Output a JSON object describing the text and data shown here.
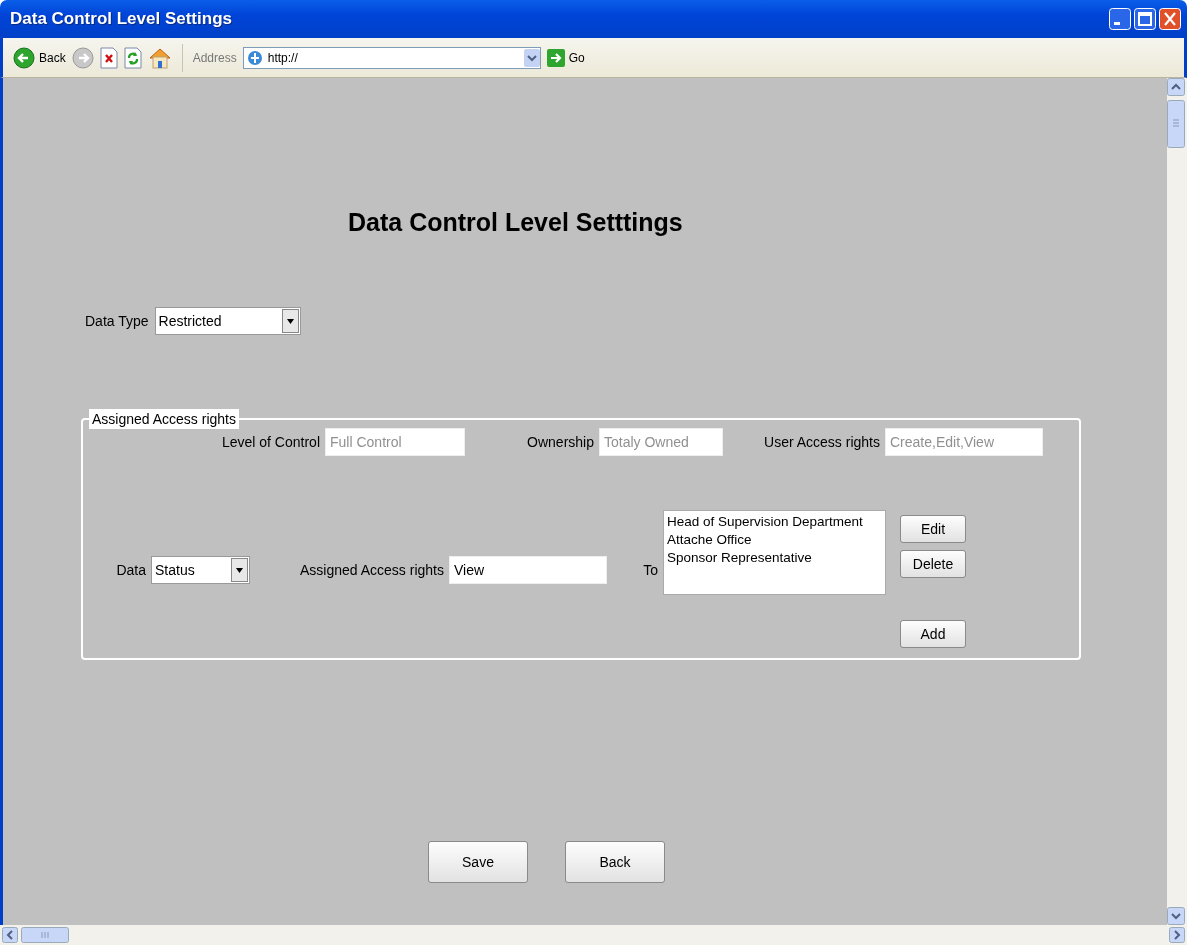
{
  "window": {
    "title": "Data Control Level Settings"
  },
  "toolbar": {
    "back_label": "Back",
    "address_label": "Address",
    "address": "http://",
    "go_label": "Go"
  },
  "page": {
    "heading": "Data Control Level Setttings",
    "data_type": {
      "label": "Data Type",
      "value": "Restricted"
    },
    "access_group": {
      "legend": "Assigned Access rights",
      "info_fields": [
        {
          "label": "Level of Control",
          "value": "Full Control",
          "disabled": true
        },
        {
          "label": "Ownership",
          "value": "Totaly Owned",
          "disabled": true
        },
        {
          "label": "User Access rights",
          "value": "Create,Edit,View",
          "disabled": true
        }
      ],
      "data": {
        "label": "Data",
        "value": "Status"
      },
      "assigned": {
        "label": "Assigned Access rights",
        "value": "View"
      },
      "to": {
        "label": "To",
        "items": [
          {
            "text": "Head of Supervision Department",
            "selected": false
          },
          {
            "text": "Attache Office",
            "selected": false
          },
          {
            "text": "Sponsor Representative",
            "selected": false
          }
        ]
      },
      "side_buttons": [
        "Edit",
        "Delete"
      ],
      "add_button": "Add"
    },
    "buttons": [
      "Save",
      "Back"
    ]
  }
}
